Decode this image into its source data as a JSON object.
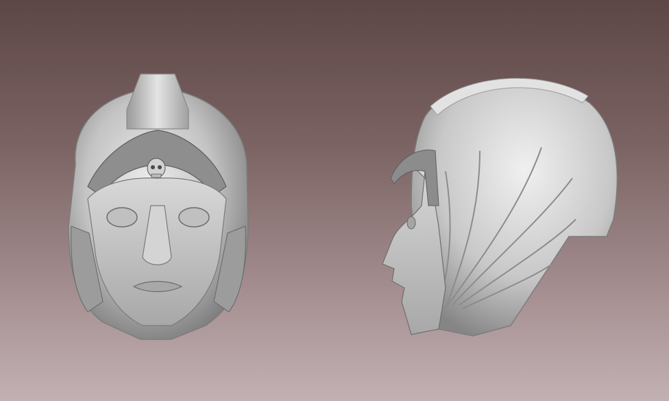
{
  "scene": {
    "views": [
      {
        "name": "front-view",
        "subject": "sculpted-helmet-head"
      },
      {
        "name": "side-view",
        "subject": "sculpted-helmet-head"
      }
    ]
  },
  "colors": {
    "background_top": "#5d4646",
    "background_bottom": "#c2b1b3",
    "clay_light": "#e6e6e6",
    "clay_mid": "#b5b5b5",
    "clay_dark": "#6e6e6e"
  }
}
